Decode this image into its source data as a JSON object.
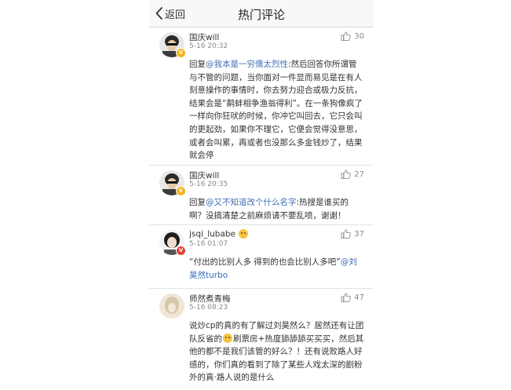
{
  "nav": {
    "back_label": "返回",
    "title": "热门评论"
  },
  "comments": [
    {
      "username": "国庆will",
      "time": "5-16 20:32",
      "likes": "30",
      "prefix": "回复",
      "mention": "@我本是一穷儒太烈性",
      "body": ":然后回答你所谓管与不管的问题，当你面对一件显而易见是在有人刻意操作的事情时，你去努力迎合或极力反抗，结果会是“鹬蚌相争渔翁得利”。在一条狗像疯了一样向你狂吠的时候，你冲它叫回去，它只会叫的更起劲，如果你不理它，它便会觉得没意思，或者会叫累，再或者也没那么多金钱炒了，结果就会停"
    },
    {
      "username": "国庆will",
      "time": "5-16 20:35",
      "likes": "27",
      "prefix": "回复",
      "mention": "@又不知道改个什么名字",
      "body": ":热搜是谁买的啊？没搞清楚之前麻烦请不要乱喷，谢谢！"
    },
    {
      "username": "jsqi_lubabe",
      "time": "5-16 01:07",
      "likes": "37",
      "body": "“付出的比别人多 得到的也会比别人多吧”",
      "mention": "@刘昊然turbo"
    },
    {
      "username": "师然煮青梅",
      "time": "5-16 08:23",
      "likes": "47",
      "body_part1": "说炒cp的真的有了解过刘昊然么？居然还有让团队反省的",
      "body_part2": "刷票房+热度舔舔舔买买买，然后其他的都不是我们该管的好么？！还有说败路人好感的，你们真的看到了除了某些人戏太深的剧粉外的真·路人说的是什么"
    }
  ]
}
